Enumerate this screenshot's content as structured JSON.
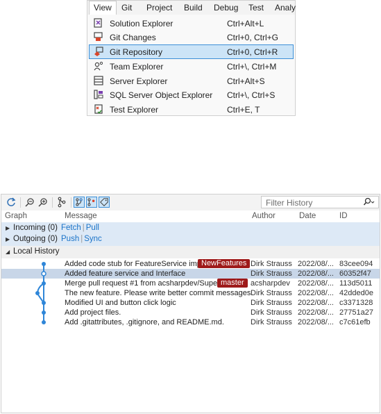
{
  "menu": {
    "bar": [
      "View",
      "Git",
      "Project",
      "Build",
      "Debug",
      "Test",
      "Analy"
    ],
    "items": [
      {
        "label": "Solution Explorer",
        "shortcut": "Ctrl+Alt+L",
        "icon": "solution-explorer-icon"
      },
      {
        "label": "Git Changes",
        "shortcut": "Ctrl+0, Ctrl+G",
        "icon": "git-changes-icon"
      },
      {
        "label": "Git Repository",
        "shortcut": "Ctrl+0, Ctrl+R",
        "icon": "git-repository-icon",
        "selected": true
      },
      {
        "label": "Team Explorer",
        "shortcut": "Ctrl+\\, Ctrl+M",
        "icon": "team-explorer-icon"
      },
      {
        "label": "Server Explorer",
        "shortcut": "Ctrl+Alt+S",
        "icon": "server-explorer-icon"
      },
      {
        "label": "SQL Server Object Explorer",
        "shortcut": "Ctrl+\\, Ctrl+S",
        "icon": "sql-server-icon"
      },
      {
        "label": "Test Explorer",
        "shortcut": "Ctrl+E, T",
        "icon": "test-explorer-icon"
      }
    ]
  },
  "history": {
    "filter_placeholder": "Filter History",
    "columns": {
      "graph": "Graph",
      "message": "Message",
      "author": "Author",
      "date": "Date",
      "id": "ID"
    },
    "incoming": {
      "label": "Incoming (0)",
      "link1": "Fetch",
      "link2": "Pull"
    },
    "outgoing": {
      "label": "Outgoing (0)",
      "link1": "Push",
      "link2": "Sync"
    },
    "local": {
      "label": "Local History"
    },
    "commits": [
      {
        "message": "Added code stub for FeatureService impl...",
        "badge": "NewFeatures",
        "author": "Dirk Strauss",
        "date": "2022/08/...",
        "id": "83cee094"
      },
      {
        "message": "Added feature service and Interface",
        "badge": "",
        "author": "Dirk Strauss",
        "date": "2022/08/...",
        "id": "60352f47",
        "selected": true
      },
      {
        "message": "Merge pull request #1 from acsharpdev/Super...",
        "badge": "master",
        "author": "acsharpdev",
        "date": "2022/08/...",
        "id": "113d5011"
      },
      {
        "message": "The new feature. Please write better commit messages.",
        "badge": "",
        "author": "Dirk Strauss",
        "date": "2022/08/...",
        "id": "42dded0e"
      },
      {
        "message": "Modified UI and button click logic",
        "badge": "",
        "author": "Dirk Strauss",
        "date": "2022/08/...",
        "id": "c3371328"
      },
      {
        "message": "Add project files.",
        "badge": "",
        "author": "Dirk Strauss",
        "date": "2022/08/...",
        "id": "27751a27"
      },
      {
        "message": "Add .gitattributes, .gitignore, and README.md.",
        "badge": "",
        "author": "Dirk Strauss",
        "date": "2022/08/...",
        "id": "c7c61efb"
      }
    ]
  },
  "colors": {
    "accent": "#3c8fd8",
    "badge": "#9e1a1a",
    "link": "#1a73c8",
    "graph": "#2f86d8"
  }
}
